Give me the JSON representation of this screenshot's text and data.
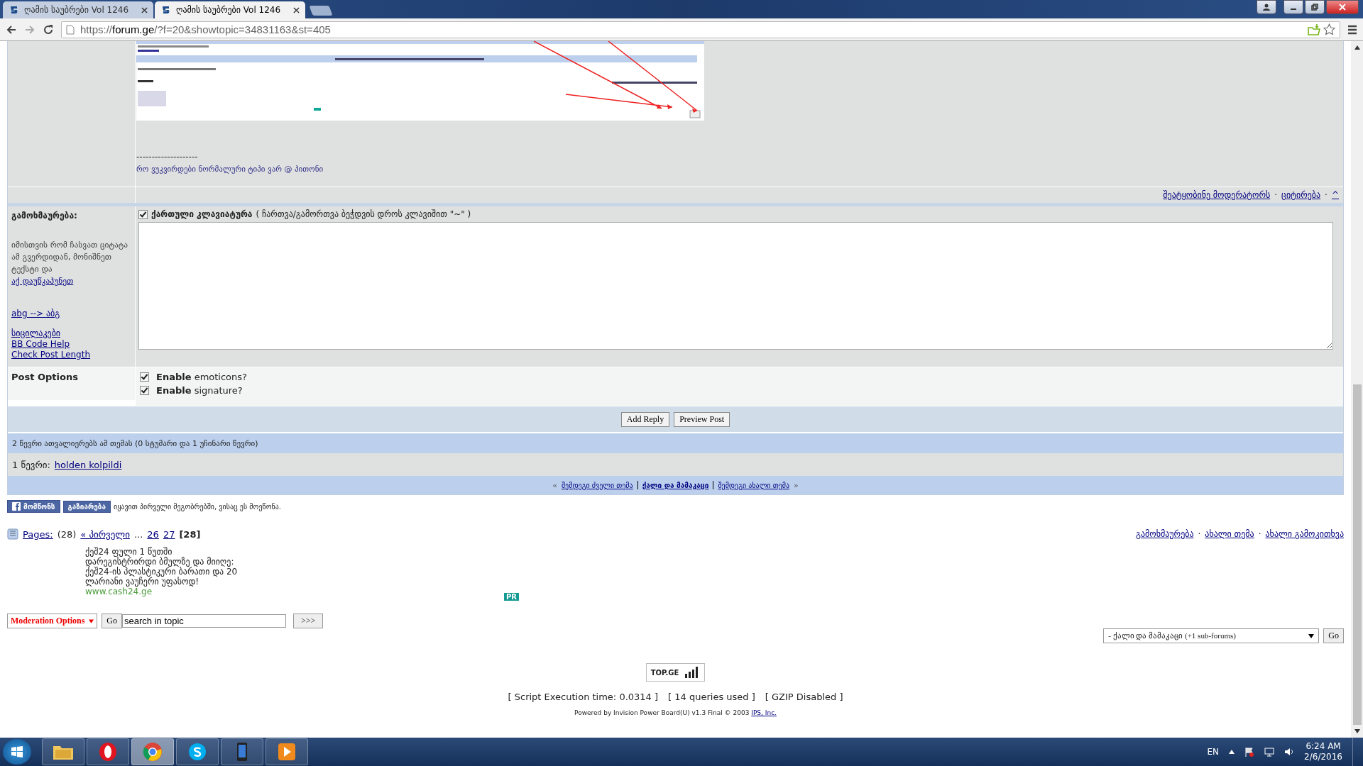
{
  "browser": {
    "tabs": [
      {
        "title": "ღამის საუბრები Vol 1246",
        "selected": false
      },
      {
        "title": "ღამის საუბრები Vol 1246",
        "selected": true
      }
    ],
    "url_scheme": "https://",
    "url_host": "forum.ge",
    "url_path": "/?f=20&showtopic=34831163&st=405"
  },
  "separator": "·",
  "post": {
    "signature_rule": "--------------------",
    "signature": "რო ვუკვირდები ნორმალური ტიპი ვარ @ პითონი",
    "actions": [
      "შეატყობინე მოდერატორს",
      "ციტირება",
      "^"
    ]
  },
  "reply": {
    "label": "გამოხმაურება:",
    "keyboard": {
      "checked": true,
      "label": "ქართული კლავიატურა",
      "hint": "( ჩართვა/გამორთვა ბეჭდვის დროს კლავიშით \"~\" )"
    },
    "hint_text": "იმისთვის რომ ჩასვათ ციტატა ამ გვერდიდან, მონიშნეთ ტექსტი და",
    "hint_link": "აქ დაუწკაპუნეთ",
    "translit_link": "abg --> აბგ",
    "help_links": [
      "სიცილაკები",
      "BB Code Help",
      "Check Post Length"
    ]
  },
  "post_options": {
    "label": "Post Options",
    "options": [
      {
        "text": "**Enable** emoticons?",
        "checked": true
      },
      {
        "text": "**Enable** signature?",
        "checked": true
      }
    ]
  },
  "buttons": [
    "Add Reply",
    "Preview Post"
  ],
  "viewers": "2 წევრი ათვალიერებს ამ თემას (0 სტუმარი და 1 უჩინარი წევრი)",
  "members": {
    "label": "1 წევრი:",
    "names": [
      "holden kolpildi"
    ]
  },
  "topic_nav": {
    "prev_mark": "«",
    "next_mark": "»",
    "items": [
      {
        "text": "შემდეგი ძველი თემა",
        "current": false
      },
      {
        "text": "ქალი და მამაკაცი",
        "current": true
      },
      {
        "text": "შემდეგი ახალი თემა",
        "current": false
      }
    ]
  },
  "social": {
    "buttons": [
      "მომწონს",
      "გაზიარება"
    ],
    "text": "იყავით პირველი მეგობრებში, ვისაც ეს მოეწონა."
  },
  "pages": {
    "label": "Pages:",
    "count": "(28)",
    "items": [
      {
        "text": "« პირველი",
        "kind": "link"
      },
      {
        "text": "...",
        "kind": "gap"
      },
      {
        "text": "26",
        "kind": "link"
      },
      {
        "text": "27",
        "kind": "link"
      },
      {
        "text": "[28]",
        "kind": "current"
      }
    ]
  },
  "thread_actions": [
    "გამოხმაურება",
    "ახალი თემა",
    "ახალი გამოკითხვა"
  ],
  "ad": {
    "lines": [
      "ქეშ24 ფული 1 წუთში",
      "დარეგისტრირდი ბმულზე და მიიღე:",
      "ქეშ24-ის პლასტიკური ბარათი და 20",
      "ლარიანი ვაუჩერი უფასოდ!"
    ],
    "url": "www.cash24.ge",
    "badge": "PR"
  },
  "moderation": {
    "select": "Moderation Options",
    "go": "Go",
    "search_value": "search in topic",
    "submit": ">>>"
  },
  "forum_jump": {
    "select": "- ქალი და მამაკაცი (+1 sub-forums)",
    "go": "Go"
  },
  "counter": "TOP.GE",
  "stats": [
    "[ Script Execution time: 0.0314 ]",
    "[ 14 queries used ]",
    "[ GZIP Disabled ]"
  ],
  "powered": {
    "text": "Powered by Invision Power Board(U) v1.3 Final © 2003",
    "link": "IPS, Inc."
  },
  "taskbar": {
    "apps": [
      {
        "kind": "folder",
        "selected": false
      },
      {
        "kind": "opera",
        "selected": false
      },
      {
        "kind": "chrome",
        "selected": true
      },
      {
        "kind": "skype",
        "selected": false
      },
      {
        "kind": "phone",
        "selected": false
      },
      {
        "kind": "player",
        "selected": false
      }
    ],
    "language": "EN",
    "time": "6:24 AM",
    "date": "2/6/2016"
  }
}
